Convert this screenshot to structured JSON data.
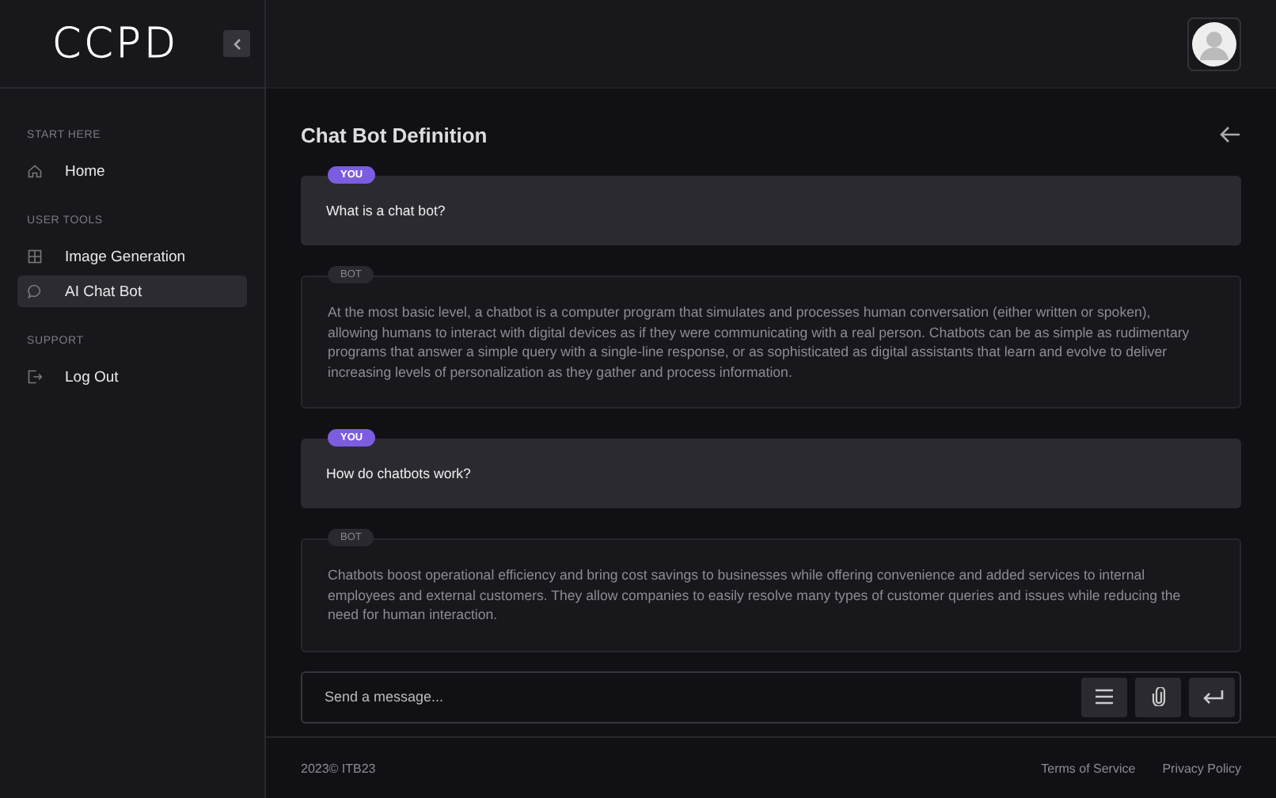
{
  "logo": "CCPD",
  "sidebar": {
    "sections": [
      {
        "heading": "START HERE",
        "items": [
          {
            "label": "Home",
            "kind": "home",
            "selected": false
          }
        ]
      },
      {
        "heading": "USER TOOLS",
        "items": [
          {
            "label": "Image Generation",
            "kind": "image",
            "selected": false
          },
          {
            "label": "AI Chat Bot",
            "kind": "chat",
            "selected": true
          }
        ]
      },
      {
        "heading": "SUPPORT",
        "items": [
          {
            "label": "Log Out",
            "kind": "logout",
            "selected": false
          }
        ]
      }
    ]
  },
  "page_title": "Chat Bot Definition",
  "messages": [
    {
      "kind": "user",
      "badge": "YOU",
      "text": "What is a chat bot?"
    },
    {
      "kind": "bot",
      "badge": "BOT",
      "text": "At the most basic level, a chatbot is a computer program that simulates and processes human conversation (either written or spoken), allowing humans to interact with digital devices as if they were communicating with a real person. Chatbots can be as simple as rudimentary programs that answer a simple query with a single-line response, or as sophisticated as digital assistants that learn and evolve to deliver increasing levels of personalization as they gather and process information."
    },
    {
      "kind": "user",
      "badge": "YOU",
      "text": "How do chatbots work?"
    },
    {
      "kind": "bot",
      "badge": "BOT",
      "text": "Chatbots boost operational efficiency and bring cost savings to businesses while offering convenience and added services to internal employees and external customers. They allow companies to easily resolve many types of customer queries and issues while reducing the need for human interaction."
    }
  ],
  "composer": {
    "placeholder": "Send a message..."
  },
  "footer": {
    "copyright": "2023© ITB23",
    "links": [
      "Terms of Service",
      "Privacy Policy"
    ]
  }
}
